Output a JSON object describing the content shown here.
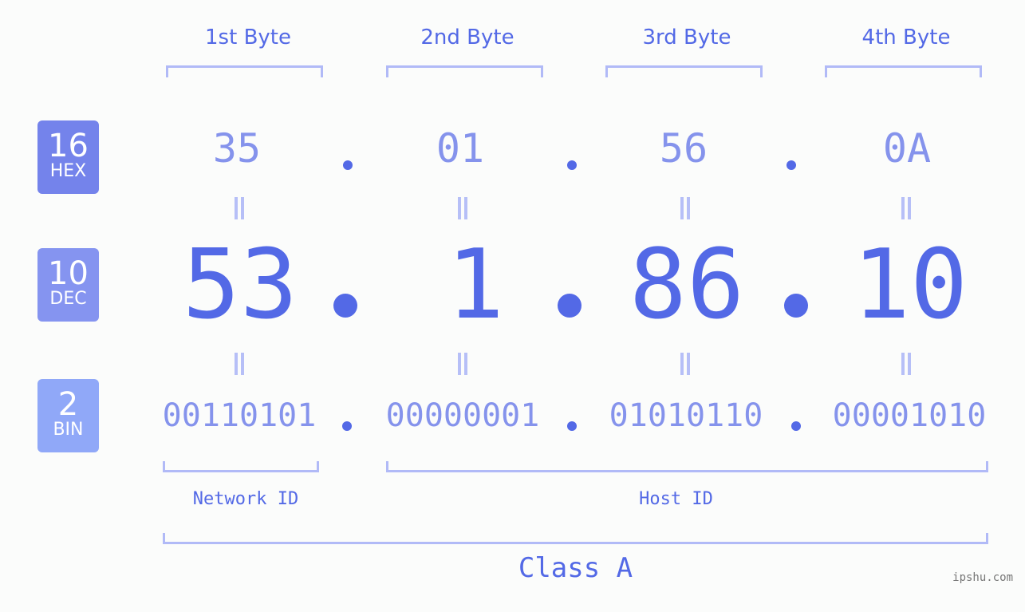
{
  "ip_address": "53.1.86.10",
  "byte_headers": [
    "1st Byte",
    "2nd Byte",
    "3rd Byte",
    "4th Byte"
  ],
  "bases": [
    {
      "number": "16",
      "label": "HEX",
      "color": "#7483eb"
    },
    {
      "number": "10",
      "label": "DEC",
      "color": "#8594f0"
    },
    {
      "number": "2",
      "label": "BIN",
      "color": "#90a8f8"
    }
  ],
  "hex": [
    "35",
    "01",
    "56",
    "0A"
  ],
  "dec": [
    "53",
    "1",
    "86",
    "10"
  ],
  "bin": [
    "00110101",
    "00000001",
    "01010110",
    "00001010"
  ],
  "separator": ".",
  "network_id_label": "Network ID",
  "host_id_label": "Host ID",
  "class_label": "Class A",
  "watermark": "ipshu.com",
  "colors": {
    "primary": "#5369e6",
    "secondary": "#8593ec",
    "bracket": "#b1baf7",
    "background": "#fbfcfb"
  }
}
